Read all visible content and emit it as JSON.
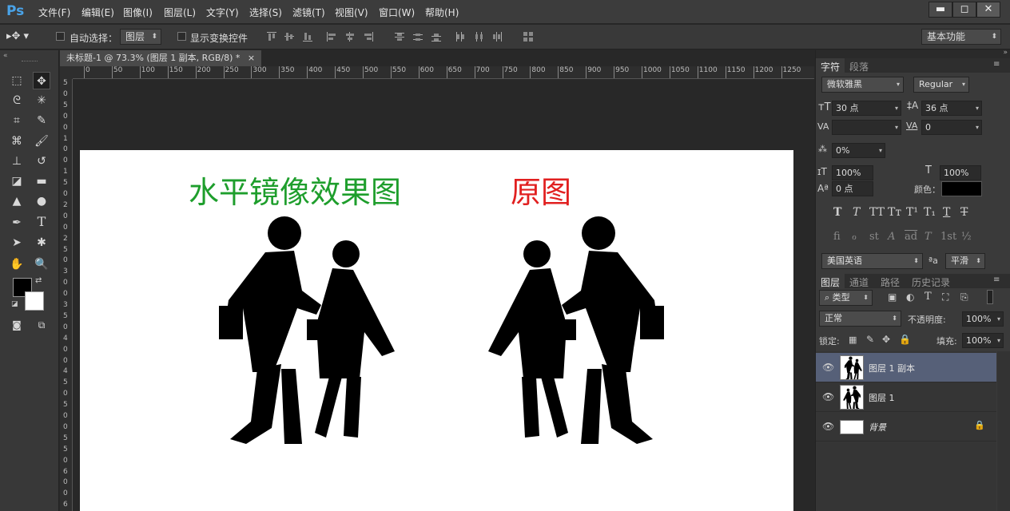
{
  "app": {
    "logo": "Ps"
  },
  "menu": [
    "文件(F)",
    "编辑(E)",
    "图像(I)",
    "图层(L)",
    "文字(Y)",
    "选择(S)",
    "滤镜(T)",
    "视图(V)",
    "窗口(W)",
    "帮助(H)"
  ],
  "window_buttons": {
    "minimize": "▬",
    "maximize": "◻",
    "close": "✕"
  },
  "options_bar": {
    "auto_select_label": "自动选择：",
    "auto_select_value": "图层",
    "show_transform_label": "显示变换控件",
    "workspace": "基本功能"
  },
  "document": {
    "tab_title": "未标题-1 @ 73.3% (图层 1 副本, RGB/8) *",
    "ruler_top_ticks": [
      "0",
      "50",
      "100",
      "150",
      "200",
      "250",
      "300",
      "350",
      "400",
      "450",
      "500",
      "550",
      "600",
      "650",
      "700",
      "750",
      "800",
      "850",
      "900",
      "950",
      "1000",
      "1050",
      "1100",
      "1150",
      "1200",
      "1250"
    ],
    "ruler_left_ticks": [
      "5",
      "0",
      "5",
      "0",
      "0",
      "1",
      "0",
      "0",
      "1",
      "5",
      "0",
      "2",
      "0",
      "0",
      "2",
      "5",
      "0",
      "3",
      "0",
      "0",
      "3",
      "5",
      "0",
      "4",
      "0",
      "0",
      "4",
      "5",
      "0",
      "5",
      "0",
      "0",
      "5",
      "5",
      "0",
      "6",
      "0",
      "0",
      "6"
    ],
    "canvas_text": {
      "left_heading": "水平镜像效果图",
      "right_heading": "原图"
    },
    "colors": {
      "left_heading": "#1e9e2c",
      "right_heading": "#e12020",
      "figure": "#000000"
    }
  },
  "character_panel": {
    "tabs": [
      "字符",
      "段落"
    ],
    "font_family": "微软雅黑",
    "font_style": "Regular",
    "font_size": "30 点",
    "leading": "36 点",
    "kerning": "",
    "tracking": "0",
    "tsume": "0%",
    "vertical_scale": "100%",
    "horizontal_scale": "100%",
    "baseline_shift": "0 点",
    "color_label": "颜色：",
    "color_value": "#000000",
    "type_buttons": [
      "T",
      "T",
      "TT",
      "Tт",
      "T¹",
      "T₁",
      "T",
      "T"
    ],
    "opentype_buttons": [
      "fi",
      "ℴ",
      "st",
      "A",
      "ad",
      "T",
      "1st",
      "½"
    ],
    "language": "美国英语",
    "aa_label": "ªa",
    "antialias": "平滑"
  },
  "layers_panel": {
    "tabs": [
      "图层",
      "通道",
      "路径",
      "历史记录"
    ],
    "filter_label": "类型",
    "blend_mode": "正常",
    "opacity_label": "不透明度:",
    "opacity": "100%",
    "lock_label": "锁定:",
    "fill_label": "填充:",
    "fill": "100%",
    "layers": [
      {
        "name": "图层 1 副本",
        "selected": true
      },
      {
        "name": "图层 1",
        "selected": false
      },
      {
        "name": "背景",
        "selected": false
      }
    ]
  }
}
